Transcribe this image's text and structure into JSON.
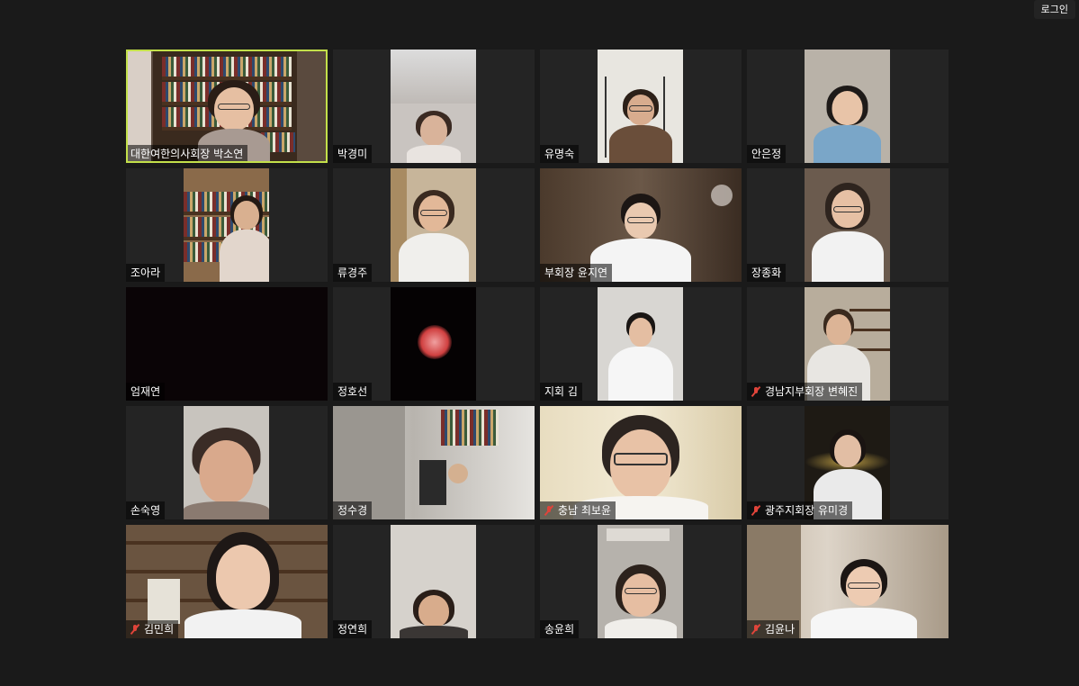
{
  "topbar": {
    "login_label": "로그인"
  },
  "participants": [
    "대한여한의사회장 박소연",
    "박경미",
    "유명숙",
    "안은정",
    "조아라",
    "류경주",
    "부회장 윤지연",
    "장종화",
    "엄재연",
    "정호선",
    "지회 김",
    "경남지부회장 변혜진",
    "손숙영",
    "정수경",
    "충남 최보윤",
    "광주지회장 유미경",
    "김민희",
    "정연희",
    "송윤희",
    "김윤나"
  ],
  "muted": [
    11,
    14,
    15,
    16,
    19
  ],
  "active_speaker": 0,
  "colors": {
    "background": "#1a1a1a",
    "tile": "#242424",
    "active_border": "#c3e04a",
    "muted_icon": "#e0443a"
  }
}
